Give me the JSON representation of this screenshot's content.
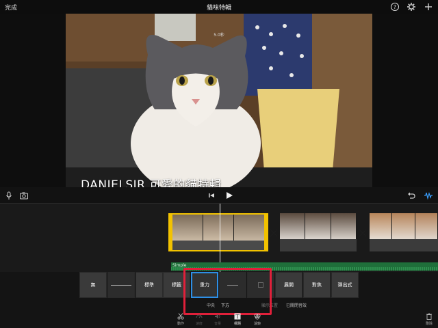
{
  "topbar": {
    "done_label": "完成",
    "title": "貓咪特輯"
  },
  "viewer": {
    "duration": "5.0秒",
    "caption": "DANIELSIR 可愛的貓特輯"
  },
  "timeline": {
    "audio_label": "Simple"
  },
  "title_styles": {
    "tiles": [
      "無",
      "",
      "標準",
      "標籤",
      "重力",
      "",
      "",
      "展開",
      "對焦",
      "彈出式"
    ],
    "active_tile": "重力"
  },
  "position_options": {
    "center": "中央",
    "lower": "下方",
    "location_info": "顯示位置",
    "theme_music": "已關閉音效"
  },
  "toolbar": {
    "items": [
      "動作",
      "速度",
      "音量",
      "標題",
      "濾鏡"
    ],
    "active": "標題",
    "delete_label": "刪除"
  },
  "colors": {
    "selection": "#f2c200",
    "active_style": "#2d8fe6",
    "audio_track": "#1f6f3a",
    "highlight_box": "#e0203a"
  }
}
